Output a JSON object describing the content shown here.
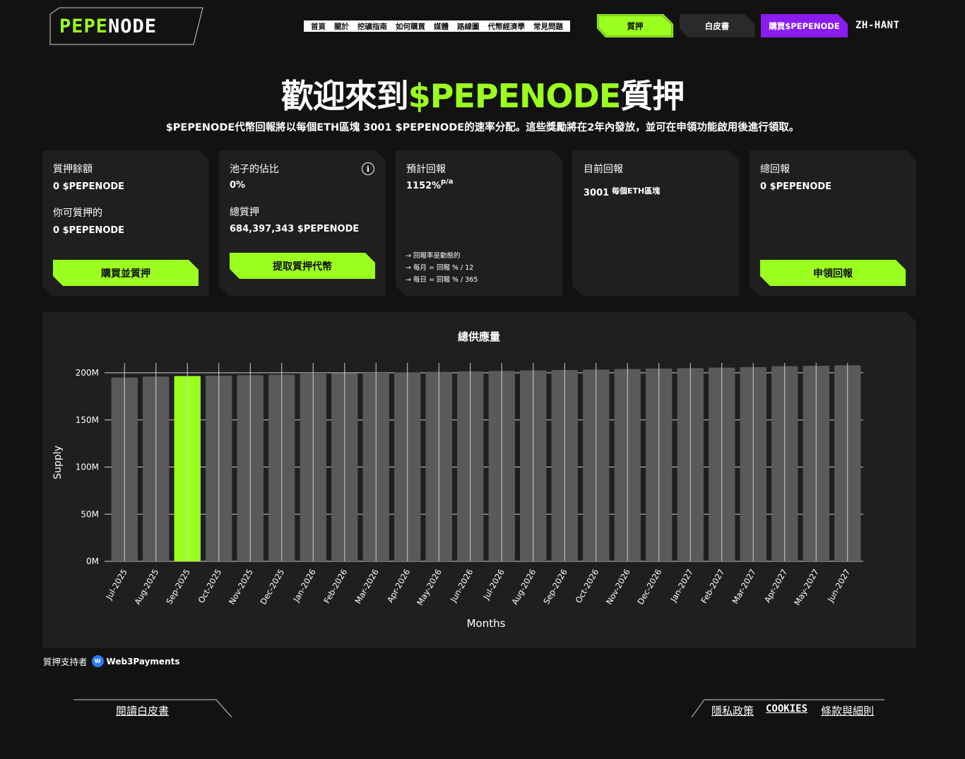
{
  "header": {
    "logo_part1": "PEPE",
    "logo_part2": "NODE",
    "nav": [
      "首頁",
      "關於",
      "挖礦指南",
      "如何購買",
      "媒體",
      "路線圖",
      "代幣經濟學",
      "常見問題"
    ],
    "stake_button": "質押",
    "whitepaper_button": "白皮書",
    "buy_button": "購買$PEPENODE",
    "language": "ZH-HANT"
  },
  "hero": {
    "title_prefix": "歡迎來到",
    "title_accent": "$PEPENODE",
    "title_suffix": "質押",
    "subtitle": "$PEPENODE代幣回報將以每個ETH區塊 3001 $PEPENODE的速率分配。這些獎勵將在2年內發放，並可在申領功能啟用後進行領取。"
  },
  "cards": {
    "balance": {
      "label": "質押餘額",
      "value": "0 $PEPENODE",
      "label2": "你可質押的",
      "value2": "0 $PEPENODE",
      "button": "購買並質押"
    },
    "pool": {
      "label": "池子的佔比",
      "value": "0%",
      "label2": "總質押",
      "value2": "684,397,343 $PEPENODE",
      "button": "提取質押代幣",
      "info_icon": "i"
    },
    "estimated": {
      "label": "預計回報",
      "value": "1152%",
      "unit": "p/a",
      "notes": [
        "→ 回報率是動態的",
        "→ 每月 = 回報 % / 12",
        "→ 每日 = 回報 % / 365"
      ]
    },
    "current": {
      "label": "目前回報",
      "value": "3001",
      "unit": "每個ETH區塊"
    },
    "total": {
      "label": "總回報",
      "value": "0 $PEPENODE",
      "button": "申領回報"
    }
  },
  "chart_data": {
    "type": "bar",
    "title": "總供應量",
    "xlabel": "Months",
    "ylabel": "Supply",
    "ylim": [
      0,
      200
    ],
    "yticks": [
      "0M",
      "50M",
      "100M",
      "150M",
      "200M"
    ],
    "ytick_values": [
      0,
      50,
      100,
      150,
      200
    ],
    "grid": true,
    "highlight_index": 2,
    "categories": [
      "Jul-2025",
      "Aug-2025",
      "Sep-2025",
      "Oct-2025",
      "Nov-2025",
      "Dec-2025",
      "Jan-2026",
      "Feb-2026",
      "Mar-2026",
      "Apr-2026",
      "May-2026",
      "Jun-2026",
      "Jul-2026",
      "Aug-2026",
      "Sep-2026",
      "Oct-2026",
      "Nov-2026",
      "Dec-2026",
      "Jan-2027",
      "Feb-2027",
      "Mar-2027",
      "Apr-2027",
      "May-2027",
      "Jun-2027"
    ],
    "values": [
      195,
      196,
      196.5,
      197,
      197.5,
      198,
      199,
      199.5,
      200,
      200.5,
      201,
      201.5,
      202,
      202.5,
      203,
      203.5,
      204,
      204.5,
      205,
      205.5,
      206,
      207,
      207.5,
      208
    ],
    "colors": {
      "bar": "#5a5a5a",
      "highlight": "#9bff1f",
      "grid": "#d0d0d0"
    }
  },
  "supporter": {
    "label": "質押支持者",
    "brand": "Web3Payments",
    "brand_icon": "W"
  },
  "footer": {
    "whitepaper_link": "閱讀白皮書",
    "links": [
      "隱私政策",
      "COOKIES",
      "條款與細則"
    ]
  },
  "colors": {
    "accent": "#9bff1f",
    "purple": "#8a1cf0",
    "background": "#121210",
    "card": "#1f1f1f"
  }
}
